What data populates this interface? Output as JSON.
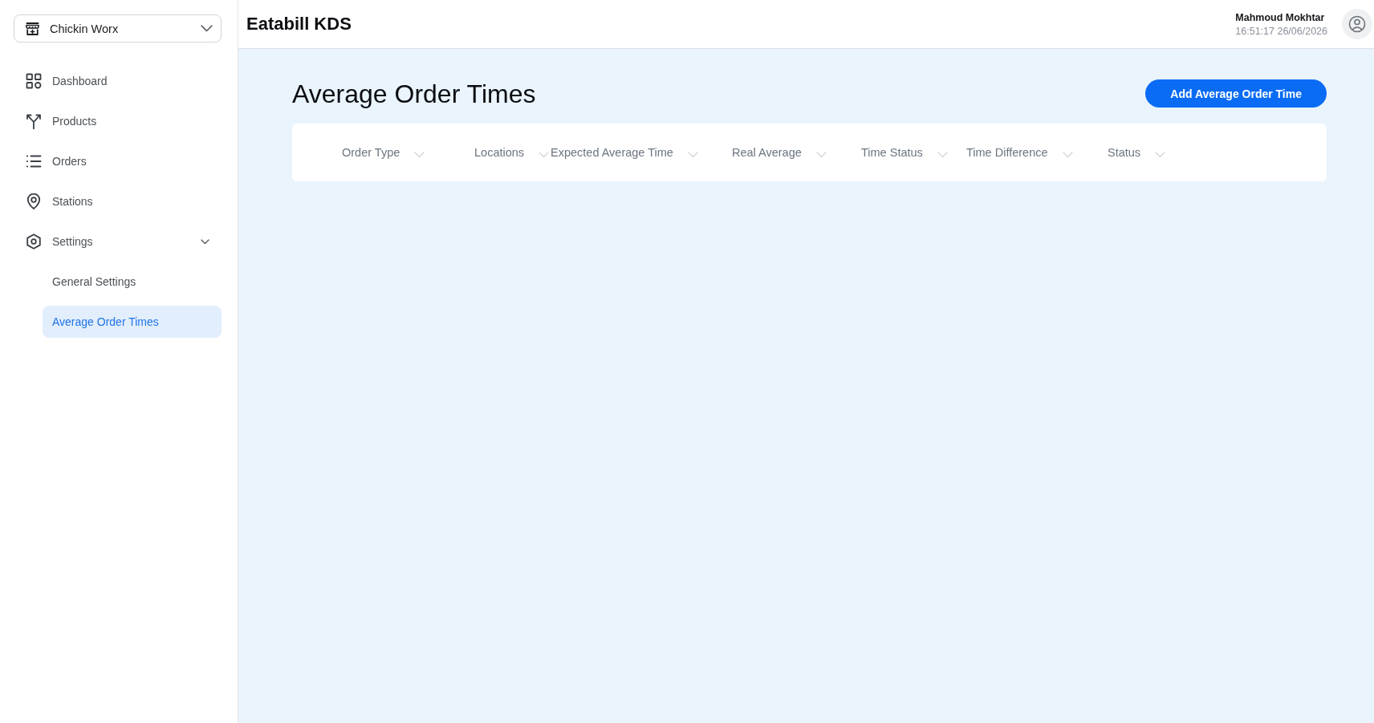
{
  "store_selector": {
    "value": "Chickin Worx"
  },
  "sidebar": {
    "items": [
      {
        "label": "Dashboard",
        "selected": false
      },
      {
        "label": "Products",
        "selected": false
      },
      {
        "label": "Orders",
        "selected": false
      },
      {
        "label": "Stations",
        "selected": false
      },
      {
        "label": "Settings",
        "selected": false,
        "expanded": true,
        "children": [
          {
            "label": "General Settings",
            "selected": false
          },
          {
            "label": "Average Order Times",
            "selected": true
          }
        ]
      }
    ]
  },
  "header": {
    "title": "Eatabill KDS",
    "user": {
      "name": "Mahmoud Mokhtar",
      "timestamp": "16:51:17 26/06/2026"
    }
  },
  "page": {
    "title": "Average Order Times",
    "primary_button": "Add Average Order Time"
  },
  "table": {
    "columns": [
      "Order Type",
      "Locations",
      "Expected Average Time",
      "Real Average",
      "Time Status",
      "Time Difference",
      "Status"
    ]
  }
}
